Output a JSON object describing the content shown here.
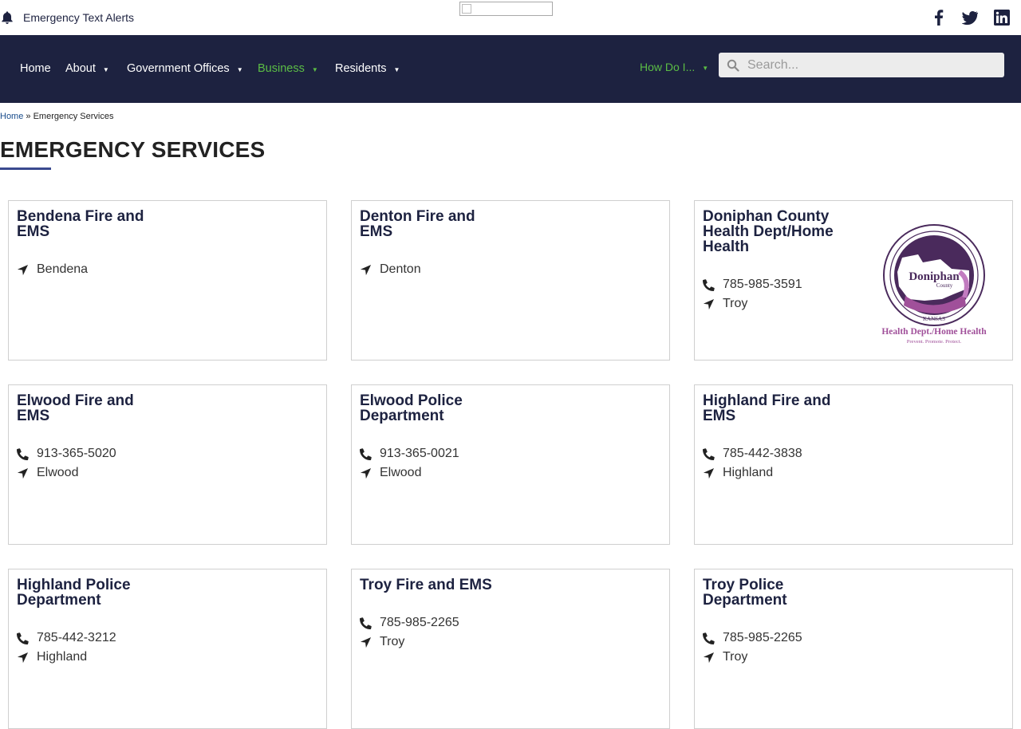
{
  "topbar": {
    "alert_label": "Emergency Text Alerts",
    "social": [
      "facebook-icon",
      "twitter-icon",
      "linkedin-icon"
    ]
  },
  "nav": {
    "items": [
      {
        "label": "Home",
        "dropdown": false
      },
      {
        "label": "About",
        "dropdown": true
      },
      {
        "label": "Government Offices",
        "dropdown": true
      },
      {
        "label": "Business",
        "dropdown": true,
        "active": true
      },
      {
        "label": "Residents",
        "dropdown": true
      }
    ],
    "how_do_i": "How Do I...",
    "search_placeholder": "Search..."
  },
  "breadcrumb": {
    "home": "Home",
    "separator": "»",
    "current": "Emergency Services"
  },
  "page_title": "EMERGENCY SERVICES",
  "cards": [
    {
      "title": "Bendena Fire and EMS",
      "location": "Bendena"
    },
    {
      "title": "Denton Fire and EMS",
      "location": "Denton"
    },
    {
      "title": "Doniphan County Health Dept/Home Health",
      "phone": "785-985-3591",
      "location": "Troy",
      "logo": {
        "name": "Doniphan",
        "sub": "County",
        "state": "KANSAS",
        "towns": "HIGHLAND · LEONA · SEVERANCE · TROY · WATHENA · WHITE CLOUD · ELWOOD · DENTON",
        "tagline": "Health Dept./Home Health",
        "motto": "Prevent. Promote. Protect."
      }
    },
    {
      "title": "Elwood Fire and EMS",
      "phone": "913-365-5020",
      "location": "Elwood"
    },
    {
      "title": "Elwood Police Department",
      "phone": "913-365-0021",
      "location": "Elwood"
    },
    {
      "title": "Highland Fire and EMS",
      "phone": "785-442-3838",
      "location": "Highland"
    },
    {
      "title": "Highland Police Department",
      "phone": "785-442-3212",
      "location": "Highland"
    },
    {
      "title": "Troy Fire and EMS",
      "phone": "785-985-2265",
      "location": "Troy"
    },
    {
      "title": "Troy Police Department",
      "phone": "785-985-2265",
      "location": "Troy"
    }
  ],
  "colors": {
    "navy": "#1d2240",
    "accent_green": "#5bbd45",
    "logo_purple": "#4a2a5c",
    "logo_magenta": "#a0509a"
  }
}
